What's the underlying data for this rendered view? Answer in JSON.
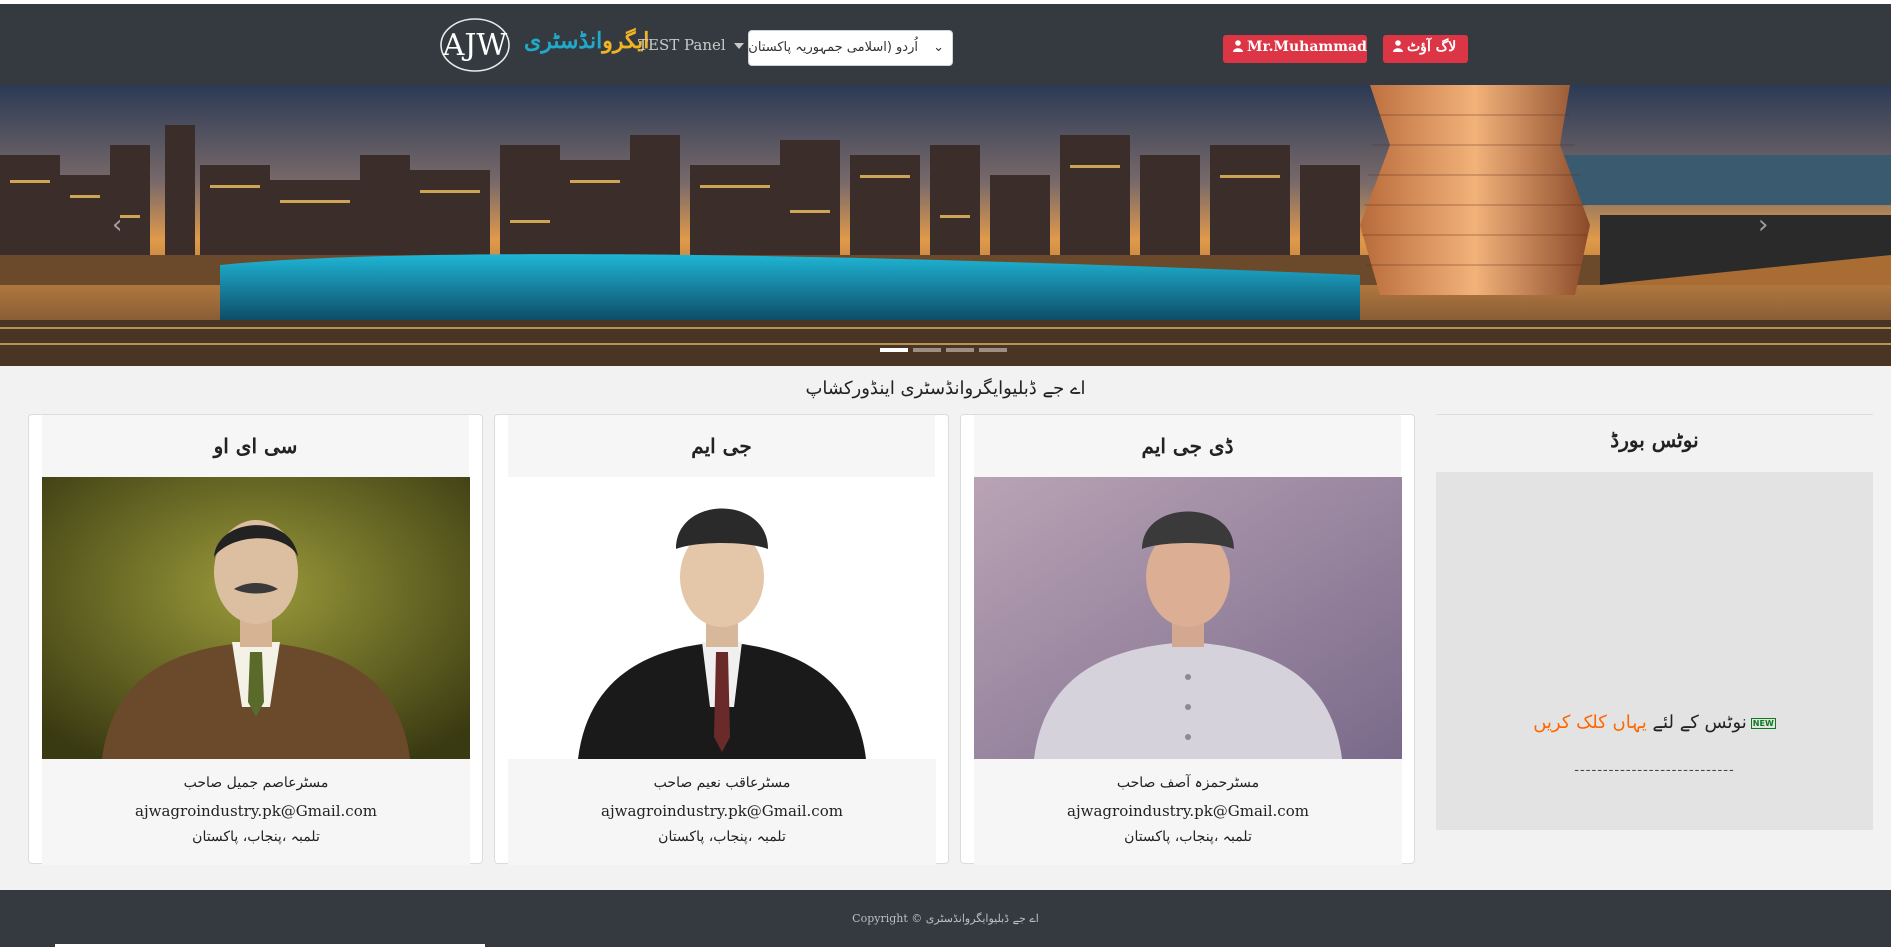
{
  "header": {
    "logo_text": "AJW",
    "brand_part1": "ایگرو",
    "brand_part2": "انڈسٹری",
    "panel_label": "TEST Panel",
    "language_selected": "اُردو (اسلامی جمہوریہ پاکستان)",
    "user_button": "Mr.Muhammad",
    "logout_button": "لاگ آؤٹ"
  },
  "carousel": {
    "prev_icon": "chevron-left-icon",
    "next_icon": "chevron-right-icon",
    "prev_glyph": "‹",
    "next_glyph": "›",
    "slide_count": 4,
    "active_slide": 1
  },
  "main": {
    "section_title": "اے جے ڈبلیوایگروانڈسٹری اینڈورکشاپ",
    "cards": [
      {
        "title": "سی ای او",
        "name": "مسٹرعاصم جمیل صاحب",
        "email": "ajwagroindustry.pk@Gmail.com",
        "location": "تلمبہ ،پنجاب، پاکستان"
      },
      {
        "title": "جی ایم",
        "name": "مسٹرعاقب نعیم صاحب",
        "email": "ajwagroindustry.pk@Gmail.com",
        "location": "تلمبہ ،پنجاب، پاکستان"
      },
      {
        "title": "ڈی جی ایم",
        "name": "مسٹرحمزہ آصف صاحب",
        "email": "ajwagroindustry.pk@Gmail.com",
        "location": "تلمبہ ،پنجاب، پاکستان"
      }
    ]
  },
  "notice": {
    "title": "نوٹس بورڈ",
    "badge": "NEW",
    "text_before": "نوٹس کے لئے ",
    "link_text": "یہاں کلک کریں",
    "dashes": "----------------------------"
  },
  "footer": {
    "copyright": "اے جے ڈبلیوایگروانڈسٹری © Copyright"
  },
  "colors": {
    "navbar": "#343a40",
    "danger": "#dc3545",
    "brand_gold": "#f0b323",
    "brand_blue": "#21a9c9",
    "link_orange": "#ff6600"
  }
}
